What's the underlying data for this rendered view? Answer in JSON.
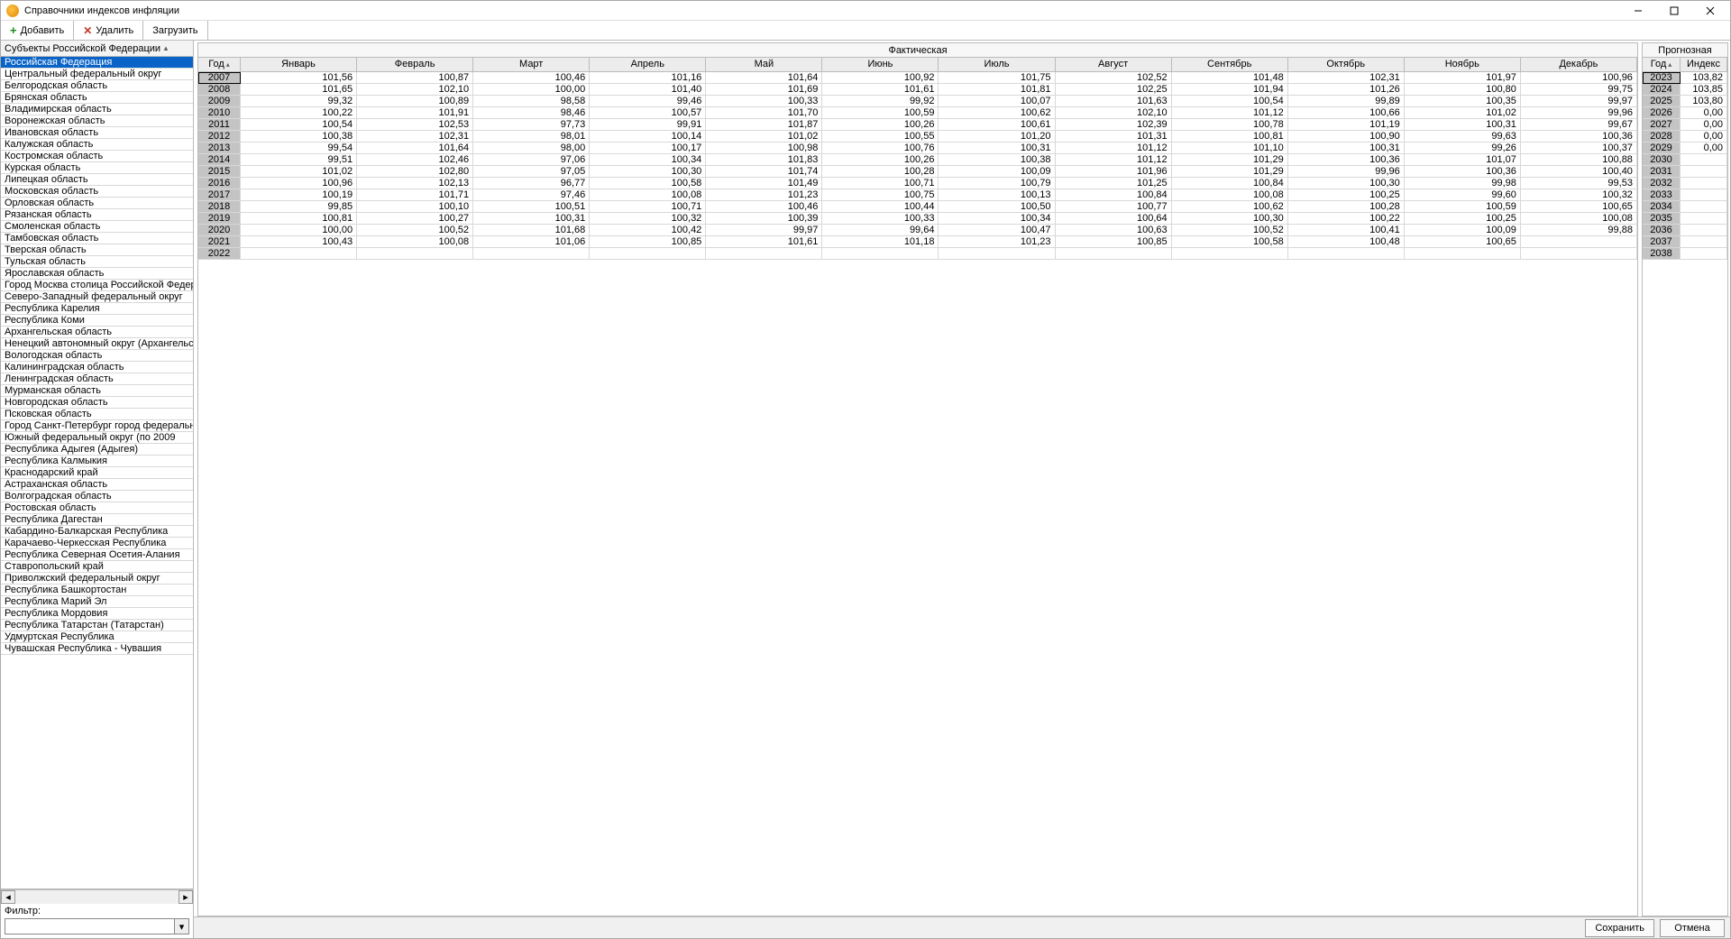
{
  "window": {
    "title": "Справочники индексов инфляции"
  },
  "toolbar": {
    "add": "Добавить",
    "delete": "Удалить",
    "load": "Загрузить"
  },
  "left": {
    "header": "Субъекты Российской Федерации",
    "filter_label": "Фильтр:",
    "selected_index": 0,
    "items": [
      "Российская Федерация",
      "Центральный федеральный округ",
      "Белгородская область",
      "Брянская область",
      "Владимирская область",
      "Воронежская область",
      "Ивановская область",
      "Калужская область",
      "Костромская область",
      "Курская область",
      "Липецкая область",
      "Московская область",
      "Орловская область",
      "Рязанская область",
      "Смоленская область",
      "Тамбовская область",
      "Тверская область",
      "Тульская область",
      "Ярославская область",
      "Город Москва столица Российской Федерации го",
      "Северо-Западный федеральный округ",
      "Республика Карелия",
      "Республика Коми",
      "Архангельская область",
      "Ненецкий автономный округ (Архангельская обла",
      "Вологодская область",
      "Калининградская область",
      "Ленинградская область",
      "Мурманская область",
      "Новгородская область",
      "Псковская область",
      "Город Санкт-Петербург город федерального знач",
      "Южный федеральный округ (по 2009",
      "Республика Адыгея (Адыгея)",
      "Республика Калмыкия",
      "Краснодарский край",
      "Астраханская область",
      "Волгоградская область",
      "Ростовская область",
      "Республика Дагестан",
      "Кабардино-Балкарская Республика",
      "Карачаево-Черкесская Республика",
      "Республика Северная Осетия-Алания",
      "Ставропольский край",
      "Приволжский федеральный округ",
      "Республика Башкортостан",
      "Республика Марий Эл",
      "Республика Мордовия",
      "Республика Татарстан (Татарстан)",
      "Удмуртская Республика",
      "Чувашская Республика - Чувашия"
    ]
  },
  "fact": {
    "title": "Фактическая",
    "year_header": "Год",
    "months": [
      "Январь",
      "Февраль",
      "Март",
      "Апрель",
      "Май",
      "Июнь",
      "Июль",
      "Август",
      "Сентябрь",
      "Октябрь",
      "Ноябрь",
      "Декабрь"
    ],
    "rows": [
      {
        "year": "2007",
        "v": [
          "101,56",
          "100,87",
          "100,46",
          "101,16",
          "101,64",
          "100,92",
          "101,75",
          "102,52",
          "101,48",
          "102,31",
          "101,97",
          "100,96"
        ]
      },
      {
        "year": "2008",
        "v": [
          "101,65",
          "102,10",
          "100,00",
          "101,40",
          "101,69",
          "101,61",
          "101,81",
          "102,25",
          "101,94",
          "101,26",
          "100,80",
          "99,75"
        ]
      },
      {
        "year": "2009",
        "v": [
          "99,32",
          "100,89",
          "98,58",
          "99,46",
          "100,33",
          "99,92",
          "100,07",
          "101,63",
          "100,54",
          "99,89",
          "100,35",
          "99,97"
        ]
      },
      {
        "year": "2010",
        "v": [
          "100,22",
          "101,91",
          "98,46",
          "100,57",
          "101,70",
          "100,59",
          "100,62",
          "102,10",
          "101,12",
          "100,66",
          "101,02",
          "99,96"
        ]
      },
      {
        "year": "2011",
        "v": [
          "100,54",
          "102,53",
          "97,73",
          "99,91",
          "101,87",
          "100,26",
          "100,61",
          "102,39",
          "100,78",
          "101,19",
          "100,31",
          "99,67"
        ]
      },
      {
        "year": "2012",
        "v": [
          "100,38",
          "102,31",
          "98,01",
          "100,14",
          "101,02",
          "100,55",
          "101,20",
          "101,31",
          "100,81",
          "100,90",
          "99,63",
          "100,36"
        ]
      },
      {
        "year": "2013",
        "v": [
          "99,54",
          "101,64",
          "98,00",
          "100,17",
          "100,98",
          "100,76",
          "100,31",
          "101,12",
          "101,10",
          "100,31",
          "99,26",
          "100,37"
        ]
      },
      {
        "year": "2014",
        "v": [
          "99,51",
          "102,46",
          "97,06",
          "100,34",
          "101,83",
          "100,26",
          "100,38",
          "101,12",
          "101,29",
          "100,36",
          "101,07",
          "100,88"
        ]
      },
      {
        "year": "2015",
        "v": [
          "101,02",
          "102,80",
          "97,05",
          "100,30",
          "101,74",
          "100,28",
          "100,09",
          "101,96",
          "101,29",
          "99,96",
          "100,36",
          "100,40"
        ]
      },
      {
        "year": "2016",
        "v": [
          "100,96",
          "102,13",
          "96,77",
          "100,58",
          "101,49",
          "100,71",
          "100,79",
          "101,25",
          "100,84",
          "100,30",
          "99,98",
          "99,53"
        ]
      },
      {
        "year": "2017",
        "v": [
          "100,19",
          "101,71",
          "97,46",
          "100,08",
          "101,23",
          "100,75",
          "100,13",
          "100,84",
          "100,08",
          "100,25",
          "99,60",
          "100,32"
        ]
      },
      {
        "year": "2018",
        "v": [
          "99,85",
          "100,10",
          "100,51",
          "100,71",
          "100,46",
          "100,44",
          "100,50",
          "100,77",
          "100,62",
          "100,28",
          "100,59",
          "100,65"
        ]
      },
      {
        "year": "2019",
        "v": [
          "100,81",
          "100,27",
          "100,31",
          "100,32",
          "100,39",
          "100,33",
          "100,34",
          "100,64",
          "100,30",
          "100,22",
          "100,25",
          "100,08"
        ]
      },
      {
        "year": "2020",
        "v": [
          "100,00",
          "100,52",
          "101,68",
          "100,42",
          "99,97",
          "99,64",
          "100,47",
          "100,63",
          "100,52",
          "100,41",
          "100,09",
          "99,88"
        ]
      },
      {
        "year": "2021",
        "v": [
          "100,43",
          "100,08",
          "101,06",
          "100,85",
          "101,61",
          "101,18",
          "101,23",
          "100,85",
          "100,58",
          "100,48",
          "100,65",
          ""
        ]
      },
      {
        "year": "2022",
        "v": [
          "",
          "",
          "",
          "",
          "",
          "",
          "",
          "",
          "",
          "",
          "",
          ""
        ]
      }
    ]
  },
  "prog": {
    "title": "Прогнозная",
    "year_header": "Год",
    "index_header": "Индекс",
    "rows": [
      {
        "year": "2023",
        "v": "103,82"
      },
      {
        "year": "2024",
        "v": "103,85"
      },
      {
        "year": "2025",
        "v": "103,80"
      },
      {
        "year": "2026",
        "v": "0,00"
      },
      {
        "year": "2027",
        "v": "0,00"
      },
      {
        "year": "2028",
        "v": "0,00"
      },
      {
        "year": "2029",
        "v": "0,00"
      },
      {
        "year": "2030",
        "v": ""
      },
      {
        "year": "2031",
        "v": ""
      },
      {
        "year": "2032",
        "v": ""
      },
      {
        "year": "2033",
        "v": ""
      },
      {
        "year": "2034",
        "v": ""
      },
      {
        "year": "2035",
        "v": ""
      },
      {
        "year": "2036",
        "v": ""
      },
      {
        "year": "2037",
        "v": ""
      },
      {
        "year": "2038",
        "v": ""
      }
    ]
  },
  "footer": {
    "save": "Сохранить",
    "cancel": "Отмена"
  }
}
